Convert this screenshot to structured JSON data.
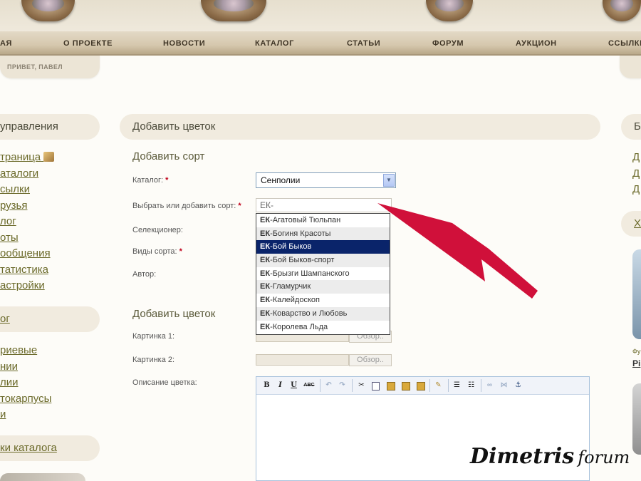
{
  "nav": {
    "items": [
      "АЯ",
      "О ПРОЕКТЕ",
      "НОВОСТИ",
      "КАТАЛОГ",
      "СТАТЬИ",
      "ФОРУМ",
      "АУКЦИОН",
      "ССЫЛКИ"
    ]
  },
  "greeting": "ПРИВЕТ, ПАВЕЛ",
  "left": {
    "control_heading": "управления",
    "control_links": [
      "траница",
      "аталоги",
      "сылки",
      "рузья",
      "лог",
      "оты",
      "ообщения",
      "татистика",
      "астройки"
    ],
    "catalog_heading": "ог",
    "catalog_links": [
      "риевые",
      "нии",
      "лии",
      "токарпусы",
      "и"
    ],
    "catalog_links_heading": "ки каталога"
  },
  "main": {
    "heading": "Добавить цветок",
    "section_sort": "Добавить сорт",
    "label_catalog": "Каталог:",
    "catalog_value": "Сенполии",
    "label_sort": "Выбрать или добавить сорт:",
    "sort_value": "ЕК-",
    "label_breeder": "Селекционер:",
    "label_types": "Виды сорта:",
    "label_author": "Автор:",
    "required_mark": "*",
    "autocomplete": [
      {
        "prefix": "ЕК",
        "rest": "-Агатовый Тюльпан"
      },
      {
        "prefix": "ЕК",
        "rest": "-Богиня Красоты"
      },
      {
        "prefix": "ЕК",
        "rest": "-Бой Быков"
      },
      {
        "prefix": "ЕК",
        "rest": "-Бой Быков-спорт"
      },
      {
        "prefix": "ЕК",
        "rest": "-Брызги Шампанского"
      },
      {
        "prefix": "ЕК",
        "rest": "-Гламурчик"
      },
      {
        "prefix": "ЕК",
        "rest": "-Калейдоскоп"
      },
      {
        "prefix": "ЕК",
        "rest": "-Коварство и Любовь"
      },
      {
        "prefix": "ЕК",
        "rest": "-Королева Льда"
      }
    ],
    "autocomplete_selected": 2,
    "section_flower": "Добавить цветок",
    "label_picture1": "Картинка 1:",
    "label_picture2": "Картинка 2:",
    "browse_label": "Обзор..",
    "label_description": "Описание цветка:"
  },
  "editor": {
    "bold": "B",
    "italic": "I",
    "underline": "U",
    "strike": "ABC"
  },
  "right": {
    "heading": "Б",
    "links": [
      "Д",
      "Д",
      "Д"
    ],
    "pill_text": "Х",
    "small_text": "Фу",
    "bold_text": "Pi"
  },
  "watermark": {
    "big": "Dimetris",
    "small": "forum"
  },
  "colors": {
    "accent_red": "#d0103a",
    "selected_row": "#0a246a",
    "link": "#6b6a2a"
  }
}
